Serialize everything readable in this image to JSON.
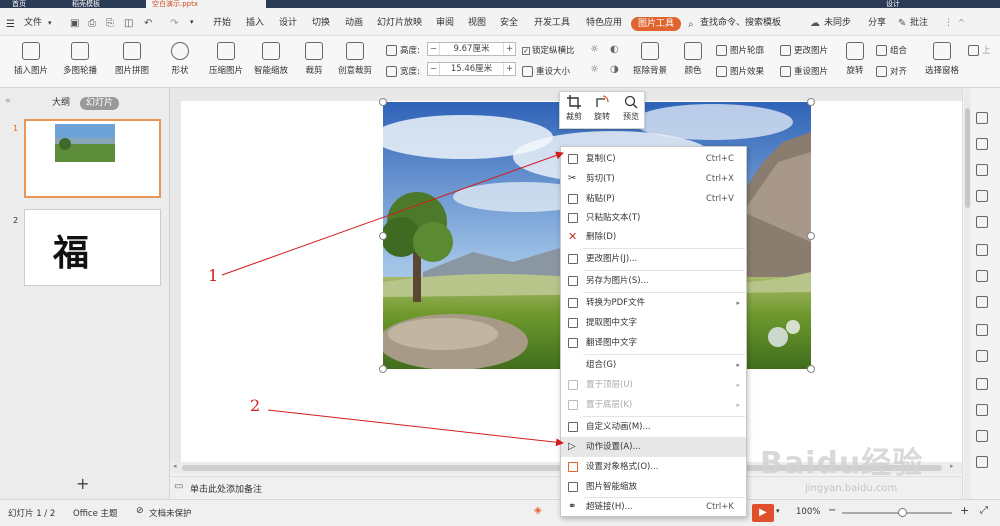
{
  "titlebar": {
    "tabs": [
      "首页",
      "稻壳模板",
      "空白演示.pptx"
    ],
    "right_label": "设计"
  },
  "menubar": {
    "file_label": "文件",
    "items": [
      "开始",
      "插入",
      "设计",
      "切换",
      "动画",
      "幻灯片放映",
      "审阅",
      "视图",
      "安全",
      "开发工具",
      "特色应用"
    ],
    "active_tool": "图片工具",
    "search_label": "查找命令、搜索模板",
    "sync_label": "未同步",
    "share_label": "分享",
    "comment_label": "批注"
  },
  "ribbon": {
    "buttons": [
      "插入图片",
      "多图轮播",
      "图片拼图",
      "形状",
      "压缩图片",
      "智能缩放",
      "裁剪",
      "创意裁剪"
    ],
    "height_label": "高度:",
    "height_value": "9.67厘米",
    "width_label": "宽度:",
    "width_value": "15.46厘米",
    "lock_ratio_label": "锁定纵横比",
    "reset_size_label": "重设大小",
    "remove_bg_label": "抠除背景",
    "color_label": "颜色",
    "outline_label": "图片轮廓",
    "effect_label": "图片效果",
    "change_pic_label": "更改图片",
    "reset_pic_label": "重设图片",
    "rotate_label": "旋转",
    "group_label": "组合",
    "align_label": "对齐",
    "select_pane_label": "选择窗格",
    "upper_label": "上"
  },
  "leftpanel": {
    "tabs": [
      "大纲",
      "幻灯片"
    ],
    "slides": [
      {
        "number": "1"
      },
      {
        "number": "2",
        "text": "福"
      }
    ]
  },
  "notes": {
    "placeholder": "单击此处添加备注"
  },
  "statusbar": {
    "slide_info": "幻灯片 1 / 2",
    "theme": "Office 主题",
    "protection": "文档未保护",
    "zoom": "100%"
  },
  "minitoolbar": {
    "items": [
      "裁剪",
      "旋转",
      "预览"
    ]
  },
  "contextmenu": {
    "items": [
      {
        "label": "复制(C)",
        "shortcut": "Ctrl+C",
        "icon": "copy-icon"
      },
      {
        "label": "剪切(T)",
        "shortcut": "Ctrl+X",
        "icon": "cut-icon"
      },
      {
        "label": "粘贴(P)",
        "shortcut": "Ctrl+V",
        "icon": "paste-icon"
      },
      {
        "label": "只粘贴文本(T)",
        "shortcut": "",
        "icon": "paste-text-icon"
      },
      {
        "label": "删除(D)",
        "shortcut": "",
        "icon": "delete-icon"
      },
      {
        "label": "更改图片(J)...",
        "shortcut": "",
        "icon": "change-picture-icon"
      },
      {
        "label": "另存为图片(S)...",
        "shortcut": "",
        "icon": "save-picture-icon"
      },
      {
        "label": "转换为PDF文件",
        "shortcut": "",
        "icon": "pdf-icon"
      },
      {
        "label": "提取图中文字",
        "shortcut": "",
        "icon": "extract-text-icon"
      },
      {
        "label": "翻译图中文字",
        "shortcut": "",
        "icon": "translate-icon"
      },
      {
        "label": "组合(G)",
        "shortcut": "",
        "icon": "group-icon"
      },
      {
        "label": "置于顶层(U)",
        "shortcut": "",
        "icon": "bring-front-icon"
      },
      {
        "label": "置于底层(K)",
        "shortcut": "",
        "icon": "send-back-icon"
      },
      {
        "label": "自定义动画(M)...",
        "shortcut": "",
        "icon": "animation-icon"
      },
      {
        "label": "动作设置(A)...",
        "shortcut": "",
        "icon": "action-icon"
      },
      {
        "label": "设置对象格式(O)...",
        "shortcut": "",
        "icon": "format-icon"
      },
      {
        "label": "图片智能缩放",
        "shortcut": "",
        "icon": "smart-zoom-icon"
      },
      {
        "label": "超链接(H)...",
        "shortcut": "Ctrl+K",
        "icon": "link-icon"
      }
    ]
  },
  "annotations": {
    "label1": "1",
    "label2": "2",
    "color": "#d21d1d"
  },
  "watermark": {
    "text": "Baidu经验",
    "url": "jingyan.baidu.com"
  },
  "colors": {
    "accent": "#e0642e",
    "title_bar": "#2b3a55",
    "selected_thumb_border": "#e8955a"
  }
}
